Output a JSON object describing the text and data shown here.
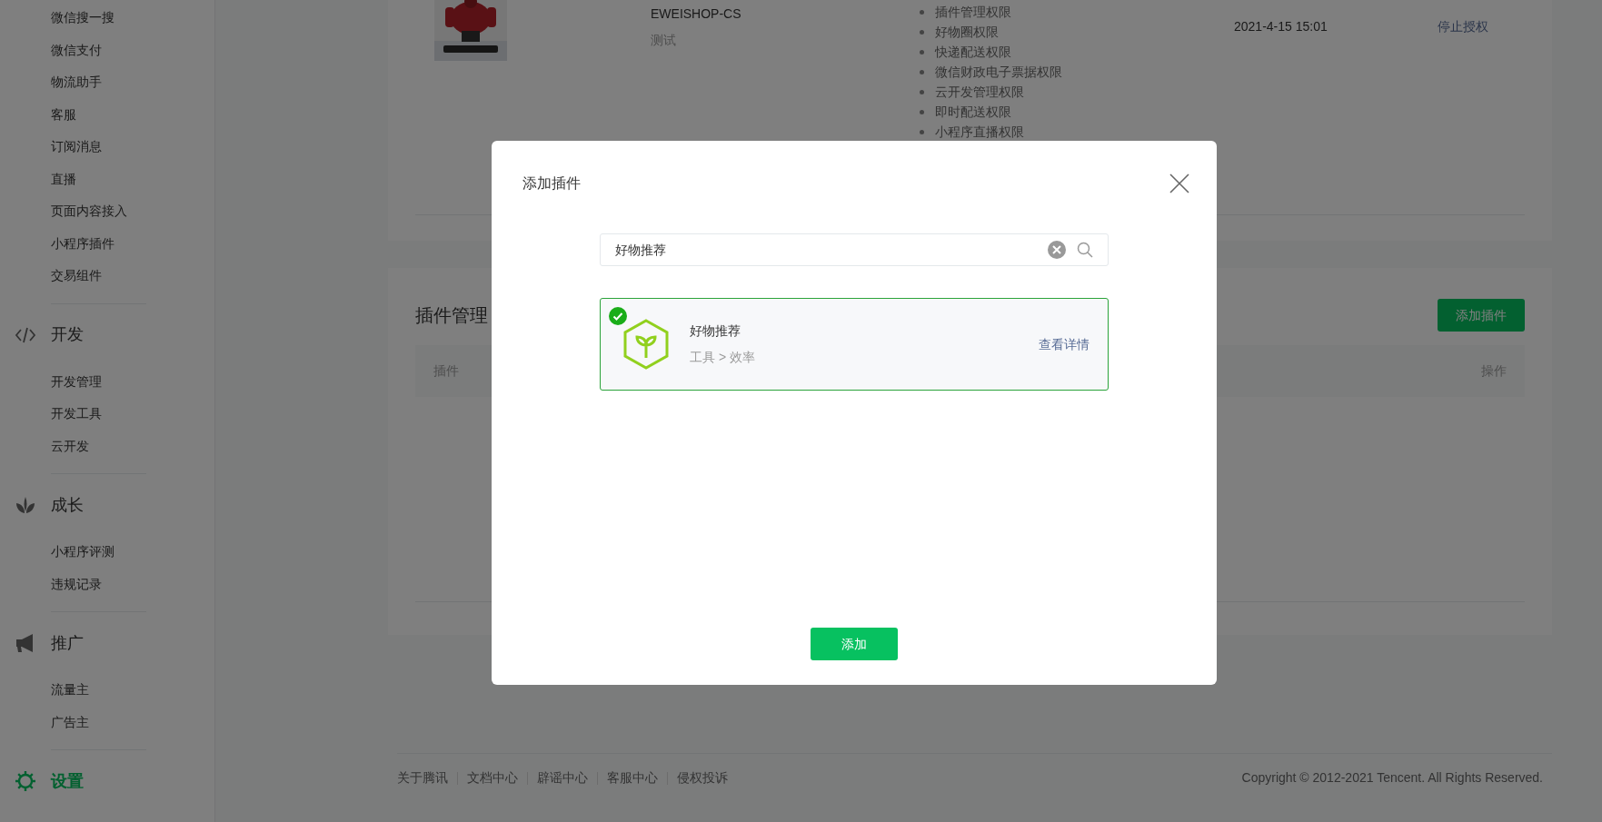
{
  "sidebar": {
    "top_items": [
      "微信搜一搜",
      "微信支付",
      "物流助手",
      "客服",
      "订阅消息",
      "直播",
      "页面内容接入",
      "小程序插件",
      "交易组件"
    ],
    "sections": [
      {
        "title": "开发",
        "kind": "code",
        "selected": false,
        "items": [
          "开发管理",
          "开发工具",
          "云开发"
        ]
      },
      {
        "title": "成长",
        "kind": "sprout",
        "selected": false,
        "items": [
          "小程序评测",
          "违规记录"
        ]
      },
      {
        "title": "推广",
        "kind": "megaphone",
        "selected": false,
        "items": [
          "流量主",
          "广告主"
        ]
      },
      {
        "title": "设置",
        "kind": "gear",
        "selected": true
      }
    ]
  },
  "authorized_app": {
    "name": "EWEISHOP-CS",
    "description": "测试",
    "permissions": [
      "插件管理权限",
      "好物圈权限",
      "快递配送权限",
      "微信财政电子票据权限",
      "云开发管理权限",
      "即时配送权限",
      "小程序直播权限"
    ],
    "time": "2021-4-15 15:01",
    "action": "停止授权"
  },
  "plugin_panel": {
    "title": "插件管理",
    "add_button": "添加插件",
    "columns": [
      "插件",
      "操作"
    ]
  },
  "dialog": {
    "title": "添加插件",
    "search": {
      "value": "好物推荐"
    },
    "results": [
      {
        "name": "好物推荐",
        "category": "工具 > 效率",
        "link": "查看详情",
        "selected": true
      }
    ],
    "confirm_button": "添加"
  },
  "footer": {
    "links": [
      "关于腾讯",
      "文档中心",
      "辟谣中心",
      "客服中心",
      "侵权投诉"
    ],
    "copyright": "Copyright © 2012-2021 Tencent. All Rights Reserved."
  }
}
